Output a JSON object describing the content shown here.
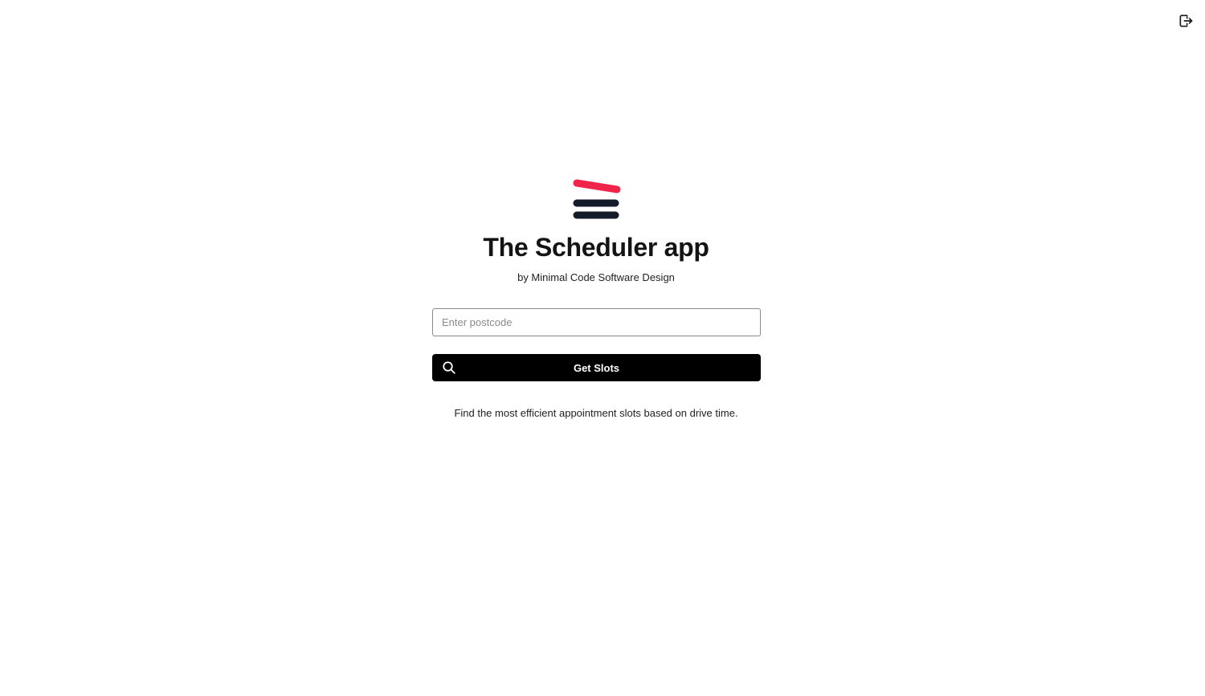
{
  "app": {
    "title": "The Scheduler app",
    "subtitle": "by Minimal Code Software Design",
    "description": "Find the most efficient appointment slots based on drive time."
  },
  "form": {
    "postcode_placeholder": "Enter postcode",
    "postcode_value": "",
    "submit_label": "Get Slots"
  },
  "icons": {
    "logo": "logo-icon",
    "logout": "logout-icon",
    "search": "search-icon"
  },
  "colors": {
    "logo_accent": "#f0244a",
    "logo_dark": "#141b29",
    "button_bg": "#000000",
    "button_text": "#ffffff"
  }
}
